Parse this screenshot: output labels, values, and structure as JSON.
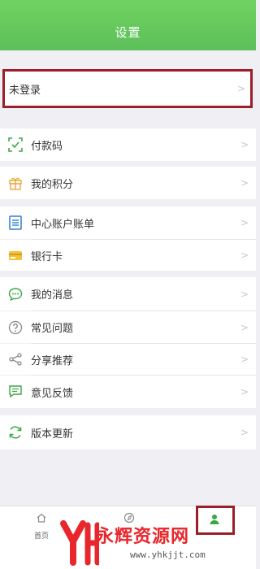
{
  "header": {
    "title": "设置"
  },
  "login": {
    "label": "未登录"
  },
  "menu": {
    "pay_code": "付款码",
    "points": "我的积分",
    "bills": "中心账户账单",
    "bank_card": "银行卡",
    "messages": "我的消息",
    "faq": "常见问题",
    "share": "分享推荐",
    "feedback": "意见反馈",
    "update": "版本更新"
  },
  "tabbar": {
    "home_label": "首页"
  },
  "watermark": {
    "logo_text": "永辉资源网",
    "url": "www.yhkjjt.com"
  },
  "colors": {
    "header_green": "#5cbf5a",
    "accent_green": "#3aa845",
    "highlight_red": "#9b1e2a"
  }
}
